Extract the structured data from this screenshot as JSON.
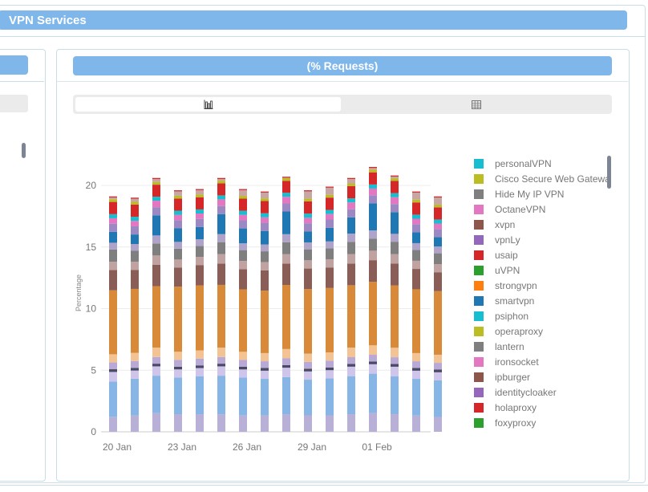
{
  "section": {
    "title": "VPN Services"
  },
  "card": {
    "title": "(% Requests)"
  },
  "toggle": {
    "active_icon": "bar-chart-icon",
    "inactive_icon": "table-icon"
  },
  "chart_data": {
    "type": "bar",
    "stacked": true,
    "ylabel": "Percentage",
    "ylim": [
      0,
      20
    ],
    "yticks": [
      0,
      5,
      10,
      15,
      20
    ],
    "grid": true,
    "legend_placement": "right",
    "x_tick_labels": [
      "20 Jan",
      "23 Jan",
      "26 Jan",
      "29 Jan",
      "01 Feb"
    ],
    "categories": [
      "20 Jan",
      "21 Jan",
      "22 Jan",
      "23 Jan",
      "24 Jan",
      "25 Jan",
      "26 Jan",
      "27 Jan",
      "28 Jan",
      "29 Jan",
      "30 Jan",
      "31 Jan",
      "01 Feb",
      "02 Feb",
      "03 Feb",
      "04 Feb"
    ],
    "totals": [
      19.1,
      19.0,
      20.6,
      19.6,
      19.7,
      20.6,
      19.7,
      19.5,
      20.7,
      19.6,
      19.9,
      20.6,
      21.5,
      20.8,
      19.5,
      19.1
    ],
    "segments": [
      {
        "color": "#b9b0d8",
        "values": [
          1.1,
          1.2,
          1.4,
          1.3,
          1.3,
          1.3,
          1.2,
          1.2,
          1.3,
          1.2,
          1.2,
          1.3,
          1.4,
          1.3,
          1.2,
          1.1
        ]
      },
      {
        "color": "#86b5e6",
        "values": [
          2.6,
          2.7,
          2.8,
          2.7,
          2.8,
          2.9,
          2.8,
          2.7,
          2.8,
          2.6,
          2.7,
          2.8,
          2.9,
          2.8,
          2.7,
          2.7
        ]
      },
      {
        "color": "#cfc4ea",
        "values": [
          0.7,
          0.6,
          0.7,
          0.6,
          0.6,
          0.7,
          0.6,
          0.6,
          0.7,
          0.6,
          0.6,
          0.7,
          0.7,
          0.7,
          0.6,
          0.6
        ]
      },
      {
        "color": "#4a4a66",
        "values": [
          0.2,
          0.2,
          0.2,
          0.2,
          0.2,
          0.2,
          0.2,
          0.2,
          0.2,
          0.2,
          0.2,
          0.2,
          0.2,
          0.2,
          0.2,
          0.2
        ]
      },
      {
        "color": "#b9a9d6",
        "values": [
          0.5,
          0.5,
          0.5,
          0.5,
          0.5,
          0.5,
          0.5,
          0.5,
          0.5,
          0.5,
          0.5,
          0.5,
          0.5,
          0.5,
          0.5,
          0.5
        ]
      },
      {
        "color": "#f3c393",
        "values": [
          0.6,
          0.6,
          0.7,
          0.6,
          0.6,
          0.7,
          0.6,
          0.6,
          0.7,
          0.6,
          0.6,
          0.7,
          0.7,
          0.7,
          0.6,
          0.6
        ]
      },
      {
        "color": "#d98a38",
        "values": [
          4.7,
          4.7,
          4.6,
          4.8,
          4.8,
          4.7,
          4.6,
          4.6,
          4.8,
          4.7,
          4.7,
          4.6,
          4.7,
          4.6,
          4.7,
          4.7
        ]
      },
      {
        "color": "#8a5d57",
        "values": [
          1.5,
          1.4,
          1.6,
          1.4,
          1.5,
          1.6,
          1.5,
          1.5,
          1.6,
          1.5,
          1.5,
          1.6,
          1.6,
          1.6,
          1.5,
          1.4
        ]
      },
      {
        "color": "#c0a3a0",
        "values": [
          0.6,
          0.6,
          0.7,
          0.6,
          0.6,
          0.7,
          0.6,
          0.6,
          0.7,
          0.6,
          0.6,
          0.7,
          0.7,
          0.7,
          0.6,
          0.6
        ]
      },
      {
        "color": "#7f7f7f",
        "values": [
          0.9,
          0.8,
          0.9,
          0.8,
          0.8,
          0.9,
          0.8,
          0.8,
          0.9,
          0.8,
          0.8,
          0.9,
          0.9,
          0.9,
          0.8,
          0.8
        ]
      },
      {
        "color": "#b0a3c9",
        "values": [
          0.5,
          0.5,
          0.6,
          0.5,
          0.5,
          0.6,
          0.5,
          0.5,
          0.6,
          0.5,
          0.5,
          0.6,
          0.6,
          0.6,
          0.5,
          0.5
        ]
      },
      {
        "color": "#1f77b4",
        "values": [
          0.8,
          0.7,
          1.5,
          1.0,
          0.9,
          1.5,
          1.1,
          1.0,
          1.7,
          0.8,
          1.0,
          1.2,
          2.0,
          1.6,
          0.8,
          0.7
        ]
      },
      {
        "color": "#9c89c4",
        "values": [
          0.6,
          0.6,
          0.6,
          0.6,
          0.6,
          0.6,
          0.6,
          0.6,
          0.6,
          0.6,
          0.6,
          0.6,
          0.6,
          0.6,
          0.6,
          0.6
        ]
      },
      {
        "color": "#e377c2",
        "values": [
          0.4,
          0.4,
          0.5,
          0.4,
          0.4,
          0.5,
          0.4,
          0.4,
          0.5,
          0.4,
          0.4,
          0.5,
          0.5,
          0.5,
          0.4,
          0.4
        ]
      },
      {
        "color": "#17becf",
        "values": [
          0.3,
          0.3,
          0.3,
          0.3,
          0.3,
          0.3,
          0.3,
          0.3,
          0.3,
          0.3,
          0.3,
          0.3,
          0.3,
          0.3,
          0.3,
          0.3
        ]
      },
      {
        "color": "#d62728",
        "values": [
          0.9,
          0.9,
          0.9,
          0.9,
          0.9,
          0.9,
          0.9,
          0.9,
          0.9,
          0.9,
          0.9,
          0.9,
          0.9,
          0.9,
          0.9,
          0.9
        ]
      },
      {
        "color": "#bcbd22",
        "values": [
          0.2,
          0.2,
          0.2,
          0.2,
          0.2,
          0.2,
          0.2,
          0.2,
          0.2,
          0.2,
          0.2,
          0.2,
          0.2,
          0.2,
          0.2,
          0.2
        ]
      },
      {
        "color": "#c7a6a3",
        "values": [
          0.2,
          0.3,
          0.3,
          0.4,
          0.4,
          0.2,
          0.5,
          0.5,
          0.1,
          0.6,
          0.6,
          0.4,
          0.2,
          0.2,
          0.6,
          0.6
        ]
      }
    ],
    "legend": [
      {
        "label": "personalVPN",
        "color": "#17becf"
      },
      {
        "label": "Cisco Secure Web Gatewa",
        "color": "#bcbd22"
      },
      {
        "label": "Hide My IP VPN",
        "color": "#7f7f7f"
      },
      {
        "label": "OctaneVPN",
        "color": "#e377c2"
      },
      {
        "label": "xvpn",
        "color": "#8c564b"
      },
      {
        "label": "vpnLy",
        "color": "#9467bd"
      },
      {
        "label": "usaip",
        "color": "#d62728"
      },
      {
        "label": "uVPN",
        "color": "#2ca02c"
      },
      {
        "label": "strongvpn",
        "color": "#ff7f0e"
      },
      {
        "label": "smartvpn",
        "color": "#1f77b4"
      },
      {
        "label": "psiphon",
        "color": "#17becf"
      },
      {
        "label": "operaproxy",
        "color": "#bcbd22"
      },
      {
        "label": "lantern",
        "color": "#7f7f7f"
      },
      {
        "label": "ironsocket",
        "color": "#e377c2"
      },
      {
        "label": "ipburger",
        "color": "#8c564b"
      },
      {
        "label": "identitycloaker",
        "color": "#9467bd"
      },
      {
        "label": "holaproxy",
        "color": "#d62728"
      },
      {
        "label": "foxyproxy",
        "color": "#2ca02c"
      }
    ]
  }
}
